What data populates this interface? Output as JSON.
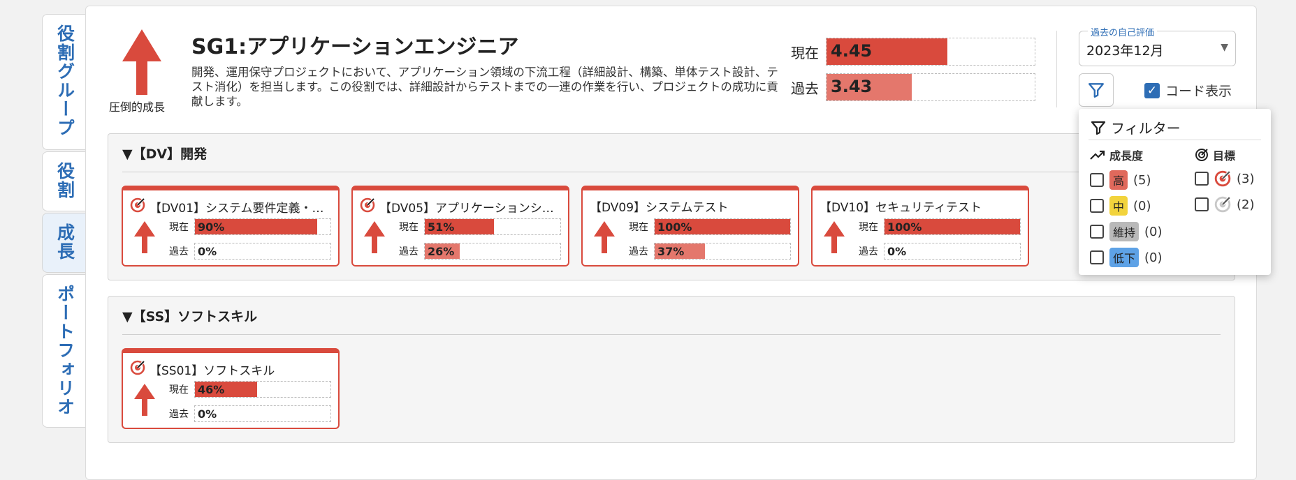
{
  "tabs": [
    {
      "label": "役割グループ"
    },
    {
      "label": "役割"
    },
    {
      "label": "成長"
    },
    {
      "label": "ポートフォリオ"
    }
  ],
  "header": {
    "arrow_label": "圧倒的成長",
    "title": "SG1:アプリケーションエンジニア",
    "description": "開発、運用保守プロジェクトにおいて、アプリケーション領域の下流工程（詳細設計、構築、単体テスト設計、テスト消化）を担当します。この役割では、詳細設計からテストまでの一連の作業を行い、プロジェクトの成功に貢献します。",
    "current_label": "現在",
    "current_value": "4.45",
    "current_fraction": 0.58,
    "past_label": "過去",
    "past_value": "3.43",
    "past_fraction": 0.41
  },
  "controls": {
    "past_eval_legend": "過去の自己評価",
    "past_eval_value": "2023年12月",
    "code_display_label": "コード表示",
    "code_display_checked": true
  },
  "sections": [
    {
      "title": "▼【DV】開発",
      "cards": [
        {
          "title": "【DV01】システム要件定義・…",
          "target": true,
          "current_label": "現在",
          "current": "90%",
          "current_fraction": 0.9,
          "past_label": "過去",
          "past": "0%",
          "past_fraction": 0
        },
        {
          "title": "【DV05】アプリケーションシ…",
          "target": true,
          "current_label": "現在",
          "current": "51%",
          "current_fraction": 0.51,
          "past_label": "過去",
          "past": "26%",
          "past_fraction": 0.26
        },
        {
          "title": "【DV09】システムテスト",
          "target": false,
          "current_label": "現在",
          "current": "100%",
          "current_fraction": 1.0,
          "past_label": "過去",
          "past": "37%",
          "past_fraction": 0.37
        },
        {
          "title": "【DV10】セキュリティテスト",
          "target": false,
          "current_label": "現在",
          "current": "100%",
          "current_fraction": 1.0,
          "past_label": "過去",
          "past": "0%",
          "past_fraction": 0
        }
      ]
    },
    {
      "title": "▼【SS】ソフトスキル",
      "cards": [
        {
          "title": "【SS01】ソフトスキル",
          "target": true,
          "current_label": "現在",
          "current": "46%",
          "current_fraction": 0.46,
          "past_label": "過去",
          "past": "0%",
          "past_fraction": 0
        }
      ]
    }
  ],
  "filter": {
    "title": "フィルター",
    "growth_head": "成長度",
    "target_head": "目標",
    "growth_items": [
      {
        "label": "高",
        "count": "(5)",
        "color": "#e0695c"
      },
      {
        "label": "中",
        "count": "(0)",
        "color": "#f2d33c"
      },
      {
        "label": "維持",
        "count": "(0)",
        "color": "#b9b9b9"
      },
      {
        "label": "低下",
        "count": "(0)",
        "color": "#5ea2e6"
      }
    ],
    "target_items": [
      {
        "count": "(3)",
        "icon": "target-red-icon"
      },
      {
        "count": "(2)",
        "icon": "target-gray-icon"
      }
    ]
  },
  "colors": {
    "accent_red": "#d94a3d",
    "past_red": "#e4776c",
    "accent_blue": "#2d6db5"
  }
}
